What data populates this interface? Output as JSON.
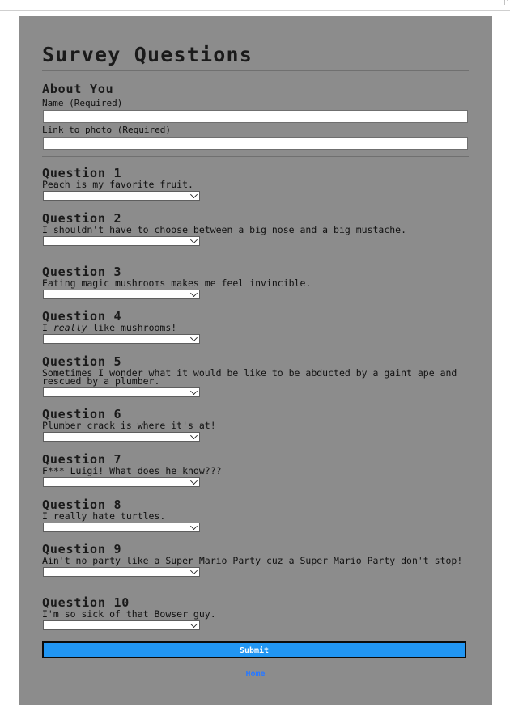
{
  "page": {
    "title": "Survey Questions",
    "about_section": {
      "title": "About You",
      "name_label": "Name (Required)",
      "name_value": "",
      "photo_label": "Link to photo (Required)",
      "photo_value": ""
    }
  },
  "questions": [
    {
      "title": "Question 1",
      "text": "Peach is my favorite fruit.",
      "selected": ""
    },
    {
      "title": "Question 2",
      "text": "I shouldn't have to choose between a big nose and a big mustache.",
      "selected": ""
    },
    {
      "title": "Question 3",
      "text": "Eating magic mushrooms makes me feel invincible.",
      "selected": ""
    },
    {
      "title": "Question 4",
      "text_pre": "I ",
      "text_em": "really",
      "text_post": " like mushrooms!",
      "selected": ""
    },
    {
      "title": "Question 5",
      "text": "Sometimes I wonder what it would be like to be abducted by a gaint ape and rescued by a plumber.",
      "selected": ""
    },
    {
      "title": "Question 6",
      "text": "Plumber crack is where it's at!",
      "selected": ""
    },
    {
      "title": "Question 7",
      "text": "F*** Luigi! What does he know???",
      "selected": ""
    },
    {
      "title": "Question 8",
      "text": "I really hate turtles.",
      "selected": ""
    },
    {
      "title": "Question 9",
      "text": "Ain't no party like a Super Mario Party cuz a Super Mario Party don't stop!",
      "selected": ""
    },
    {
      "title": "Question 10",
      "text": "I'm so sick of that Bowser guy.",
      "selected": ""
    }
  ],
  "actions": {
    "submit_label": "Submit",
    "home_label": "Home"
  },
  "colors": {
    "card_background": "#8c8c8c",
    "submit_button": "#2196f3",
    "home_link": "#2979ff"
  }
}
